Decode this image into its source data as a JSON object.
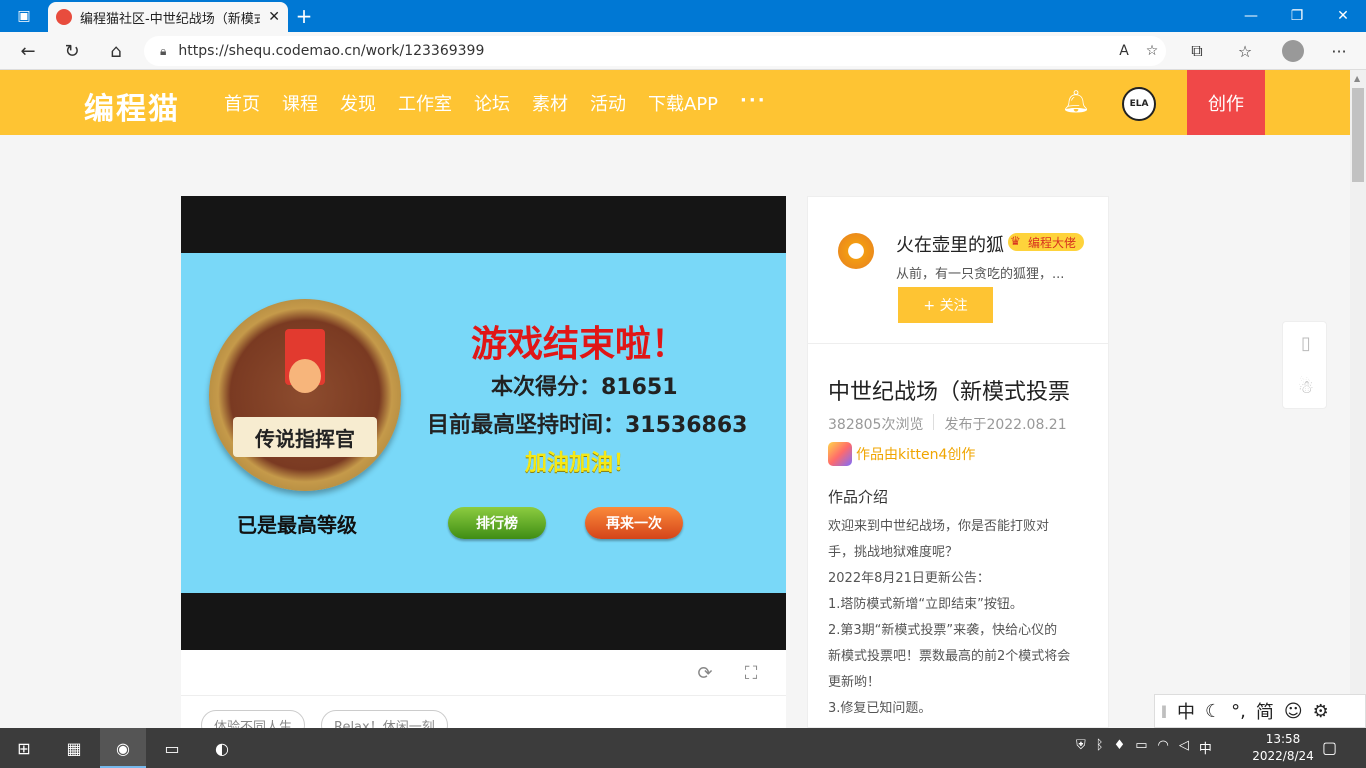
{
  "browser": {
    "tab_title": "编程猫社区-中世纪战场（新模式",
    "tab_close": "✕",
    "new_tab": "+",
    "url": "https://shequ.codemao.cn/work/123369399",
    "win_min": "—",
    "win_max": "❐",
    "win_close": "✕"
  },
  "site": {
    "logo": "编程猫",
    "menu": [
      "首页",
      "课程",
      "发现",
      "工作室",
      "论坛",
      "素材",
      "活动",
      "下载APP"
    ],
    "more": "···",
    "avatar_text": "ELA",
    "create_label": "创作"
  },
  "game": {
    "medal_label": "传说指挥官",
    "level_text": "已是最高等级",
    "over_title": "游戏结束啦！",
    "score_text": "本次得分：81651",
    "best_text": "目前最高坚持时间：31536863",
    "cheer_text": "加油加油！",
    "rank_button": "排行榜",
    "again_button": "再来一次"
  },
  "tags": [
    "体验不同人生",
    "Relax！休闲一刻"
  ],
  "author": {
    "name": "火在壶里的狐",
    "badge": "编程大佬",
    "desc": "从前，有一只贪吃的狐狸，...",
    "follow_label": "+ 关注"
  },
  "work": {
    "title": "中世纪战场（新模式投票",
    "views": "382805次浏览",
    "published": "发布于2022.08.21",
    "made_by": "作品由kitten4创作",
    "intro_title": "作品介绍",
    "intro_lines": [
      "欢迎来到中世纪战场，你是否能打败对",
      "手，挑战地狱难度呢？",
      "2022年8月21日更新公告：",
      "1.塔防模式新增“立即结束”按钮。",
      "2.第3期“新模式投票”来袭，快给心仪的",
      "新模式投票吧！票数最高的前2个模式将会",
      "更新哟！",
      "3.修复已知问题。"
    ]
  },
  "ime": [
    "中",
    "☾",
    "°,",
    "简",
    "☺",
    "⚙"
  ],
  "taskbar": {
    "tray_lang": "中",
    "time": "13:58",
    "date": "2022/8/24"
  }
}
